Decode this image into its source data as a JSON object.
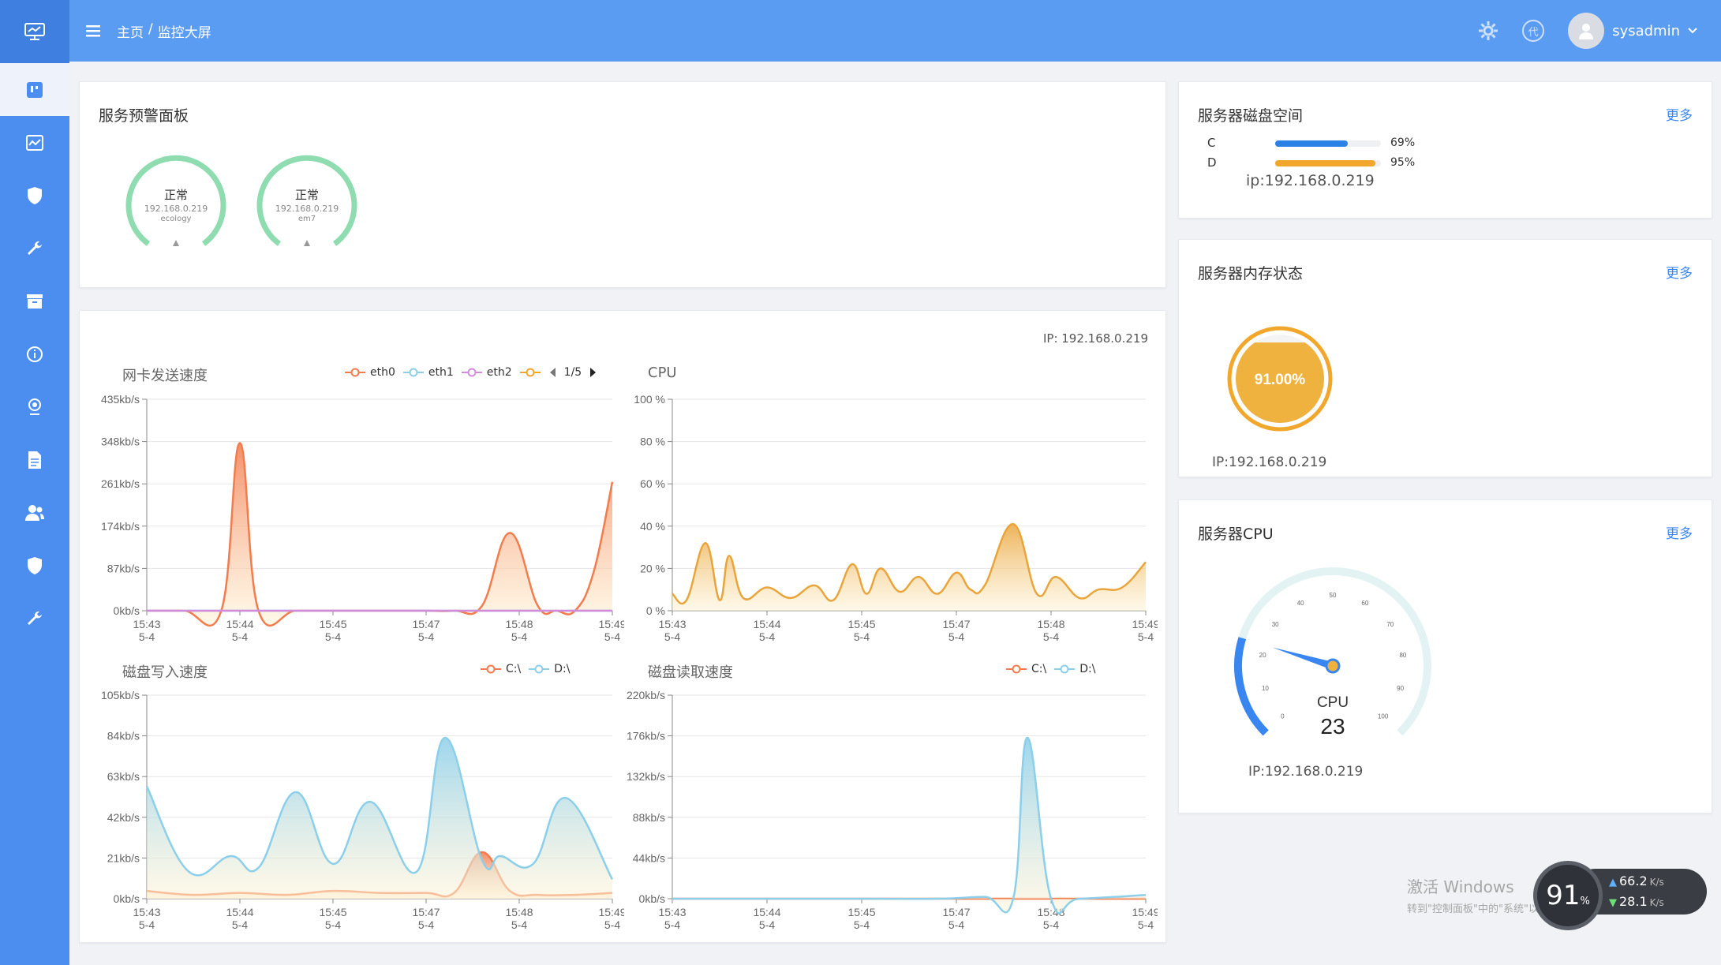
{
  "colors": {
    "sidebar": "#4b8ef0",
    "topbar": "#5b9cf3",
    "accent": "#3a86f0",
    "eth0_series": "#f27c4e",
    "d_series": "#8ccfea",
    "cpu_series": "#e9a53b",
    "gauge_green": "#8fdcb0",
    "memory_orange": "#f0a72c"
  },
  "sidebar": {
    "items": [
      {
        "icon": "monitor-icon"
      },
      {
        "icon": "dashboard-icon"
      },
      {
        "icon": "chart-icon"
      },
      {
        "icon": "shield-icon"
      },
      {
        "icon": "wrench-icon"
      },
      {
        "icon": "archive-icon"
      },
      {
        "icon": "info-icon"
      },
      {
        "icon": "location-icon"
      },
      {
        "icon": "document-icon"
      },
      {
        "icon": "users-icon"
      },
      {
        "icon": "shield-icon"
      },
      {
        "icon": "wrench-icon"
      }
    ]
  },
  "header": {
    "breadcrumb_home": "主页",
    "breadcrumb_sep": "/",
    "breadcrumb_current": "监控大屏",
    "badge_text": "代",
    "username": "sysadmin"
  },
  "alert_panel": {
    "title": "服务预警面板",
    "gauges": [
      {
        "status": "正常",
        "ip": "192.168.0.219",
        "name": "ecology"
      },
      {
        "status": "正常",
        "ip": "192.168.0.219",
        "name": "em7"
      }
    ]
  },
  "charts_panel": {
    "ip_label": "IP: 192.168.0.219",
    "net": {
      "title": "网卡发送速度",
      "legend": [
        "eth0",
        "eth1",
        "eth2"
      ],
      "page": "1/5"
    },
    "cpu": {
      "title": "CPU"
    },
    "disk_write": {
      "title": "磁盘写入速度",
      "legend": [
        "C:\\",
        "D:\\"
      ]
    },
    "disk_read": {
      "title": "磁盘读取速度",
      "legend": [
        "C:\\",
        "D:\\"
      ]
    }
  },
  "chart_data": [
    {
      "type": "area",
      "title": "网卡发送速度",
      "categories": [
        "15:43\n5-4",
        "15:44\n5-4",
        "15:45\n5-4",
        "15:47\n5-4",
        "15:48\n5-4",
        "15:49\n5-4"
      ],
      "y_ticks": [
        "0kb/s",
        "87kb/s",
        "174kb/s",
        "261kb/s",
        "348kb/s",
        "435kb/s"
      ],
      "ylim": [
        0,
        435
      ],
      "series": [
        {
          "name": "eth0",
          "color": "#f27c4e",
          "x": [
            0,
            0.4,
            0.8,
            1.0,
            1.2,
            1.6,
            2.0,
            2.6,
            3.0,
            3.3,
            3.6,
            3.9,
            4.2,
            4.4,
            4.6,
            4.8,
            5.0
          ],
          "values": [
            0,
            0,
            0,
            345,
            0,
            0,
            0,
            0,
            0,
            0,
            10,
            160,
            10,
            0,
            0,
            80,
            265
          ]
        },
        {
          "name": "eth1",
          "color": "#8ccfea",
          "x": [
            0,
            5
          ],
          "values": [
            0,
            0
          ]
        },
        {
          "name": "eth2",
          "color": "#d38bd9",
          "x": [
            0,
            5
          ],
          "values": [
            0,
            0
          ]
        }
      ]
    },
    {
      "type": "area",
      "title": "CPU",
      "categories": [
        "15:43\n5-4",
        "15:44\n5-4",
        "15:45\n5-4",
        "15:47\n5-4",
        "15:48\n5-4",
        "15:49\n5-4"
      ],
      "y_ticks": [
        "0 %",
        "20 %",
        "40 %",
        "60 %",
        "80 %",
        "100 %"
      ],
      "ylim": [
        0,
        100
      ],
      "series": [
        {
          "name": "CPU",
          "color": "#e9a53b",
          "x": [
            0,
            0.15,
            0.35,
            0.5,
            0.6,
            0.75,
            1.0,
            1.25,
            1.5,
            1.7,
            1.9,
            2.05,
            2.2,
            2.4,
            2.6,
            2.8,
            3.0,
            3.15,
            3.3,
            3.6,
            3.85,
            4.05,
            4.3,
            4.5,
            4.75,
            5.0
          ],
          "values": [
            8,
            5,
            32,
            5,
            26,
            6,
            11,
            6,
            12,
            5,
            22,
            8,
            20,
            9,
            16,
            8,
            18,
            10,
            12,
            41,
            8,
            16,
            6,
            10,
            11,
            23
          ]
        }
      ]
    },
    {
      "type": "area",
      "title": "磁盘写入速度",
      "categories": [
        "15:43\n5-4",
        "15:44\n5-4",
        "15:45\n5-4",
        "15:47\n5-4",
        "15:48\n5-4",
        "15:49\n5-4"
      ],
      "y_ticks": [
        "0kb/s",
        "21kb/s",
        "42kb/s",
        "63kb/s",
        "84kb/s",
        "105kb/s"
      ],
      "ylim": [
        0,
        105
      ],
      "series": [
        {
          "name": "C:\\",
          "color": "#f27c4e",
          "x": [
            0,
            0.5,
            1.0,
            1.5,
            2.0,
            2.5,
            3.0,
            3.3,
            3.6,
            3.9,
            4.2,
            4.6,
            5.0
          ],
          "values": [
            4,
            2,
            3,
            2,
            4,
            3,
            3,
            3,
            24,
            4,
            2,
            2,
            3
          ]
        },
        {
          "name": "D:\\",
          "color": "#8ccfea",
          "x": [
            0,
            0.45,
            0.9,
            1.2,
            1.6,
            2.0,
            2.4,
            2.9,
            3.2,
            3.6,
            3.8,
            4.15,
            4.5,
            5.0
          ],
          "values": [
            58,
            14,
            22,
            16,
            55,
            18,
            50,
            14,
            83,
            20,
            22,
            18,
            52,
            10
          ]
        }
      ]
    },
    {
      "type": "area",
      "title": "磁盘读取速度",
      "categories": [
        "15:43\n5-4",
        "15:44\n5-4",
        "15:45\n5-4",
        "15:47\n5-4",
        "15:48\n5-4",
        "15:49\n5-4"
      ],
      "y_ticks": [
        "0kb/s",
        "44kb/s",
        "88kb/s",
        "132kb/s",
        "176kb/s",
        "220kb/s"
      ],
      "ylim": [
        0,
        220
      ],
      "series": [
        {
          "name": "C:\\",
          "color": "#f27c4e",
          "x": [
            0,
            5
          ],
          "values": [
            0,
            0
          ]
        },
        {
          "name": "D:\\",
          "color": "#8ccfea",
          "x": [
            0,
            2.0,
            2.8,
            3.3,
            3.6,
            3.75,
            4.0,
            4.3,
            5.0
          ],
          "values": [
            0,
            0,
            0,
            2,
            0,
            174,
            0,
            0,
            4
          ]
        }
      ]
    }
  ],
  "disk_panel": {
    "title": "服务器磁盘空间",
    "more": "更多",
    "rows": [
      {
        "drive": "C",
        "percent_text": "69%",
        "value": 69,
        "color": "#2b82e6"
      },
      {
        "drive": "D",
        "percent_text": "95%",
        "value": 95,
        "color": "#f0a72c"
      }
    ],
    "ip": "ip:192.168.0.219"
  },
  "memory_panel": {
    "title": "服务器内存状态",
    "more": "更多",
    "value_text": "91.00%",
    "value": 91,
    "ip": "IP:192.168.0.219"
  },
  "cpu_panel": {
    "title": "服务器CPU",
    "more": "更多",
    "gauge_label": "CPU",
    "value_text": "23",
    "value": 23,
    "gauge_ticks": [
      "0",
      "10",
      "20",
      "30",
      "40",
      "50",
      "60",
      "70",
      "80",
      "90",
      "100"
    ],
    "ip": "IP:192.168.0.219"
  },
  "watermark": {
    "line1": "激活 Windows",
    "line2": "转到\"控制面板\"中的\"系统\"以激活 Windows。"
  },
  "net_widget": {
    "percent": "91",
    "percent_unit": "%",
    "up": "66.2",
    "down": "28.1",
    "unit": "K/s"
  }
}
